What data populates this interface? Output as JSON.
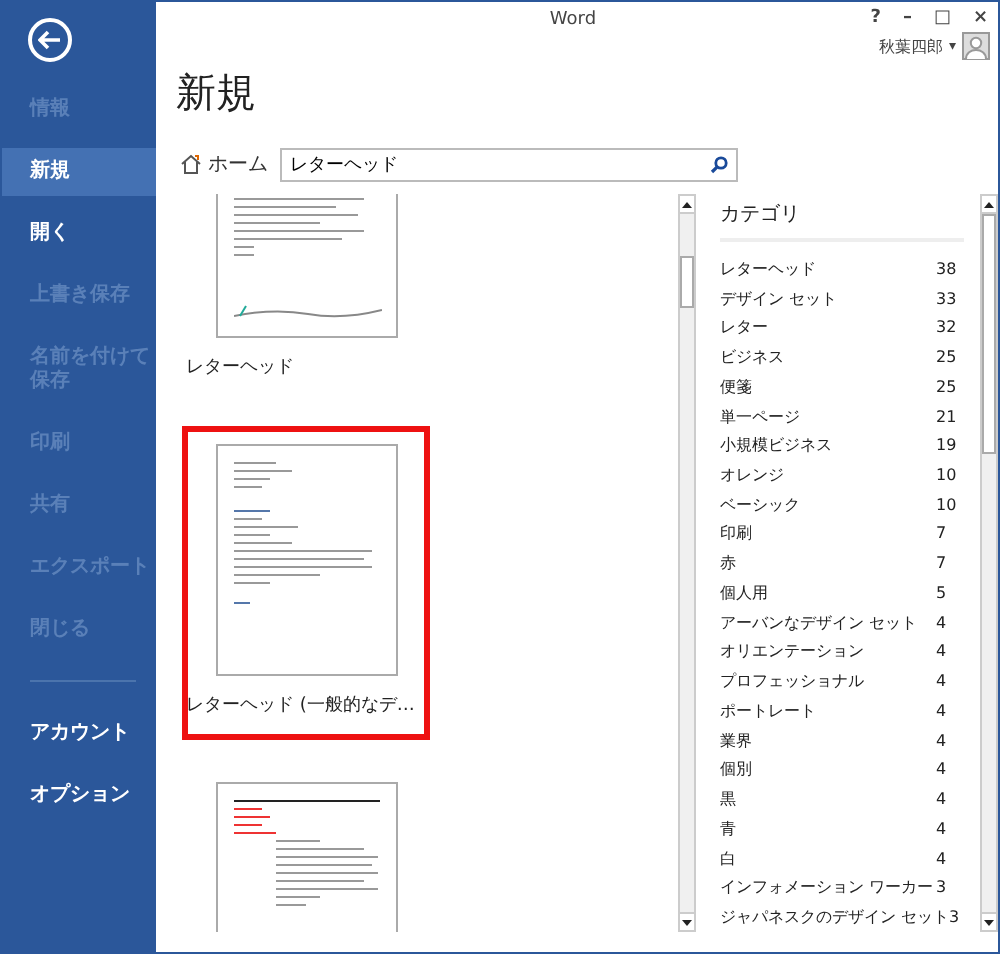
{
  "window": {
    "title": "Word",
    "controls": [
      "?",
      "–",
      "□",
      "×"
    ]
  },
  "user": {
    "name": "秋葉四郎",
    "menu_caret": "▾"
  },
  "sidebar": {
    "items": [
      {
        "label": "情報",
        "selected": false,
        "disabled": true
      },
      {
        "label": "新規",
        "selected": true,
        "disabled": false
      },
      {
        "label": "開く",
        "selected": false,
        "disabled": false
      },
      {
        "label": "上書き保存",
        "selected": false,
        "disabled": true
      },
      {
        "label": "名前を付けて保存",
        "selected": false,
        "disabled": true
      },
      {
        "label": "印刷",
        "selected": false,
        "disabled": true
      },
      {
        "label": "共有",
        "selected": false,
        "disabled": true
      },
      {
        "label": "エクスポート",
        "selected": false,
        "disabled": true
      },
      {
        "label": "閉じる",
        "selected": false,
        "disabled": true
      }
    ],
    "footer_items": [
      {
        "label": "アカウント",
        "selected": false,
        "disabled": false
      },
      {
        "label": "オプション",
        "selected": false,
        "disabled": false
      }
    ]
  },
  "page_title": "新規",
  "home_link": "ホーム",
  "search": {
    "value": "レターヘッド"
  },
  "templates": [
    {
      "kind": "wave",
      "name": "レターヘッド",
      "selected": false
    },
    {
      "kind": "classic",
      "name": "レターヘッド (一般的なデ…",
      "selected": true
    },
    {
      "kind": "sidebar",
      "selected": false
    }
  ],
  "categories": {
    "title": "カテゴリ",
    "items": [
      {
        "name": "レターヘッド",
        "count": "38"
      },
      {
        "name": "デザイン セット",
        "count": "33"
      },
      {
        "name": "レター",
        "count": "32"
      },
      {
        "name": "ビジネス",
        "count": "25"
      },
      {
        "name": "便箋",
        "count": "25"
      },
      {
        "name": "単一ページ",
        "count": "21"
      },
      {
        "name": "小規模ビジネス",
        "count": "19"
      },
      {
        "name": "オレンジ",
        "count": "10"
      },
      {
        "name": "ベーシック",
        "count": "10"
      },
      {
        "name": "印刷",
        "count": "7"
      },
      {
        "name": "赤",
        "count": "7"
      },
      {
        "name": "個人用",
        "count": "5"
      },
      {
        "name": "アーバンなデザイン セット",
        "count": "4"
      },
      {
        "name": "オリエンテーション",
        "count": "4"
      },
      {
        "name": "プロフェッショナル",
        "count": "4"
      },
      {
        "name": "ポートレート",
        "count": "4"
      },
      {
        "name": "業界",
        "count": "4"
      },
      {
        "name": "個別",
        "count": "4"
      },
      {
        "name": "黒",
        "count": "4"
      },
      {
        "name": "青",
        "count": "4"
      },
      {
        "name": "白",
        "count": "4"
      },
      {
        "name": "インフォメーション ワーカー",
        "count": "3"
      },
      {
        "name": "ジャパネスクのデザイン セット",
        "count": "3"
      }
    ]
  }
}
